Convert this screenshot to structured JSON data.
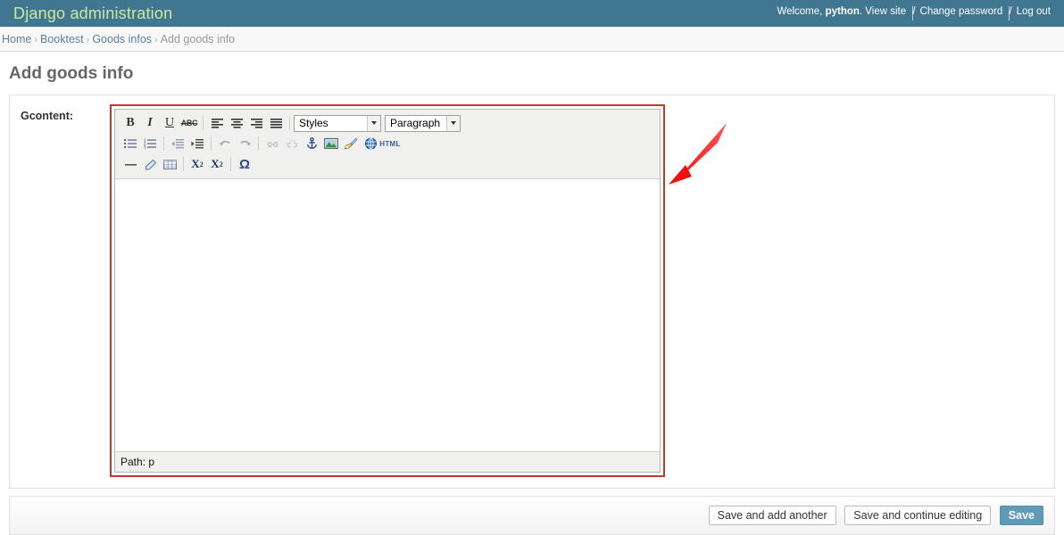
{
  "header": {
    "site_title": "Django administration",
    "welcome_prefix": "Welcome,",
    "username": "python",
    "period": ".",
    "view_site": "View site",
    "sep1": "/",
    "change_password": "Change password",
    "sep2": "/",
    "log_out": "Log out"
  },
  "breadcrumbs": {
    "home": "Home",
    "app": "Booktest",
    "model": "Goods infos",
    "current": "Add goods info",
    "separator": "›"
  },
  "page": {
    "title": "Add goods info"
  },
  "form": {
    "field_label": "Gcontent:"
  },
  "editor": {
    "toolbar_row1": [
      {
        "name": "bold-icon",
        "label": "B"
      },
      {
        "name": "italic-icon",
        "label": "I"
      },
      {
        "name": "underline-icon",
        "label": "U"
      },
      {
        "name": "strikethrough-icon",
        "label": "ABC"
      },
      {
        "name": "align-left-icon",
        "label": ""
      },
      {
        "name": "align-center-icon",
        "label": ""
      },
      {
        "name": "align-right-icon",
        "label": ""
      },
      {
        "name": "align-justify-icon",
        "label": ""
      }
    ],
    "styles_select": "Styles",
    "paragraph_select": "Paragraph",
    "toolbar_row2": [
      {
        "name": "bullet-list-icon",
        "label": ""
      },
      {
        "name": "numbered-list-icon",
        "label": ""
      },
      {
        "name": "outdent-icon",
        "label": ""
      },
      {
        "name": "indent-icon",
        "label": ""
      },
      {
        "name": "undo-icon",
        "label": ""
      },
      {
        "name": "redo-icon",
        "label": ""
      },
      {
        "name": "link-icon",
        "label": ""
      },
      {
        "name": "unlink-icon",
        "label": ""
      },
      {
        "name": "anchor-icon",
        "label": ""
      },
      {
        "name": "insert-image-icon",
        "label": ""
      },
      {
        "name": "cleanup-brush-icon",
        "label": ""
      },
      {
        "name": "globe-icon",
        "label": ""
      },
      {
        "name": "html-source-icon",
        "label": "HTML"
      }
    ],
    "toolbar_row3": [
      {
        "name": "horizontal-rule-icon",
        "label": ""
      },
      {
        "name": "remove-formatting-icon",
        "label": ""
      },
      {
        "name": "insert-table-icon",
        "label": ""
      },
      {
        "name": "subscript-icon",
        "label": "X"
      },
      {
        "name": "superscript-icon",
        "label": "X"
      },
      {
        "name": "special-character-icon",
        "label": "Ω"
      }
    ],
    "content": "",
    "status_path": "Path: p"
  },
  "submit": {
    "save_and_add_another": "Save and add another",
    "save_and_continue": "Save and continue editing",
    "save": "Save"
  },
  "colors": {
    "header_bg": "#417690",
    "brand_text": "#c9ea9f",
    "link": "#5b80a0",
    "save_button": "#609ab6",
    "annotation_red": "#ee1111",
    "highlight_border": "#c0392b"
  }
}
